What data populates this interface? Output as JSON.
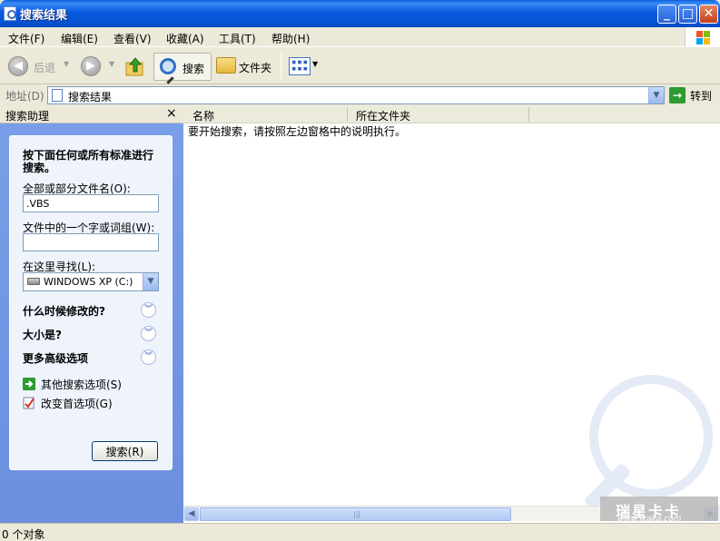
{
  "window": {
    "title": "搜索结果",
    "minimize": "_",
    "maximize": "□",
    "close": "✕"
  },
  "menu": {
    "items": [
      {
        "label": "文件(F)"
      },
      {
        "label": "编辑(E)"
      },
      {
        "label": "查看(V)"
      },
      {
        "label": "收藏(A)"
      },
      {
        "label": "工具(T)"
      },
      {
        "label": "帮助(H)"
      }
    ]
  },
  "toolbar": {
    "back_label": "后退",
    "search_label": "搜索",
    "folders_label": "文件夹"
  },
  "address": {
    "label": "地址(D)",
    "value": "搜索结果",
    "go_label": "转到"
  },
  "search_assistant": {
    "header": "搜索助理",
    "close": "×",
    "heading": "按下面任何或所有标准进行搜索。",
    "filename_label": "全部或部分文件名(O):",
    "filename_value": ".VBS",
    "phrase_label": "文件中的一个字或词组(W):",
    "phrase_value": "",
    "lookin_label": "在这里寻找(L):",
    "lookin_value": "WINDOWS XP (C:)",
    "when_modified": "什么时候修改的?",
    "size": "大小是?",
    "advanced": "更多高级选项",
    "other_options": "其他搜索选项(S)",
    "preferences": "改变首选项(G)",
    "search_button": "搜索(R)"
  },
  "results": {
    "columns": [
      "名称",
      "所在文件夹"
    ],
    "hint": "要开始搜索，请按照左边窗格中的说明执行。"
  },
  "watermark": {
    "title": "瑞星卡卡",
    "url": "www.ikaka.com"
  },
  "status": {
    "text": "0 个对象"
  },
  "colors": {
    "titlebar": "#0554d6",
    "left_pane": "#7a9fe8",
    "panel_bg": "#eef3fc",
    "go_button": "#2e9b32"
  }
}
